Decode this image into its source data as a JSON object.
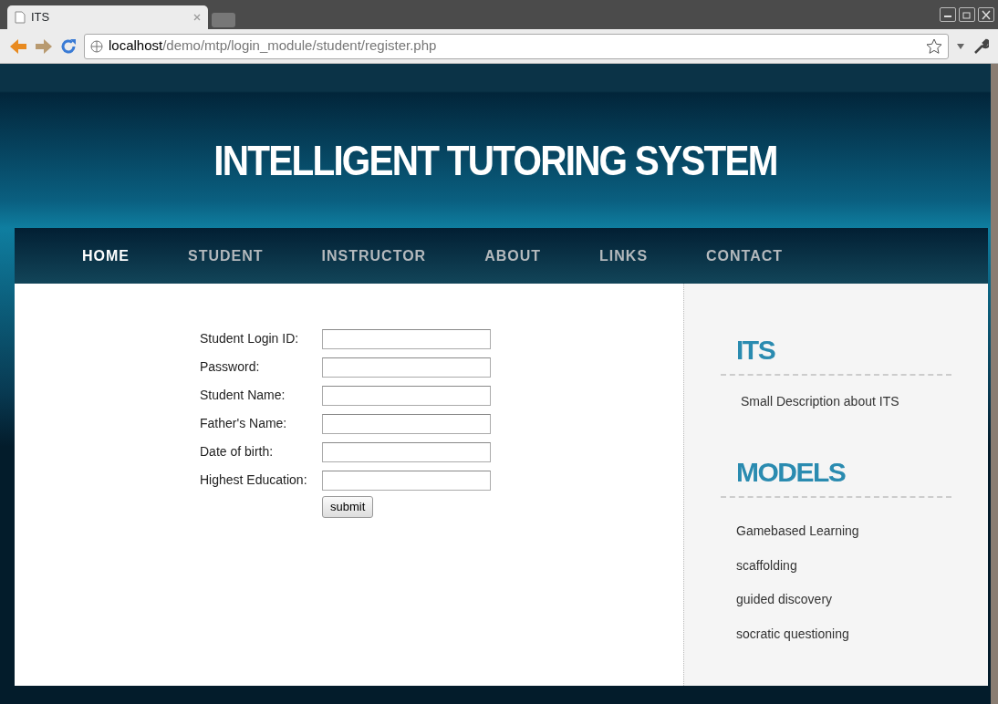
{
  "browser": {
    "tab_title": "ITS",
    "url_host": "localhost",
    "url_path": "/demo/mtp/login_module/student/register.php"
  },
  "header": {
    "title": "INTELLIGENT TUTORING SYSTEM"
  },
  "nav": [
    {
      "label": "HOME",
      "selected": true
    },
    {
      "label": "STUDENT",
      "selected": false
    },
    {
      "label": "INSTRUCTOR",
      "selected": false
    },
    {
      "label": "ABOUT",
      "selected": false
    },
    {
      "label": "LINKS",
      "selected": false
    },
    {
      "label": "CONTACT",
      "selected": false
    }
  ],
  "form": {
    "fields": [
      {
        "label": "Student Login ID:"
      },
      {
        "label": "Password:"
      },
      {
        "label": "Student Name:"
      },
      {
        "label": "Father's Name:"
      },
      {
        "label": "Date of birth:"
      },
      {
        "label": "Highest Education:"
      }
    ],
    "submit": "submit"
  },
  "sidebar": {
    "sections": [
      {
        "heading": "ITS",
        "kind": "text",
        "text": "Small Description about ITS"
      },
      {
        "heading": "MODELS",
        "kind": "links",
        "items": [
          "Gamebased Learning",
          "scaffolding",
          "guided discovery",
          "socratic questioning"
        ]
      }
    ]
  }
}
